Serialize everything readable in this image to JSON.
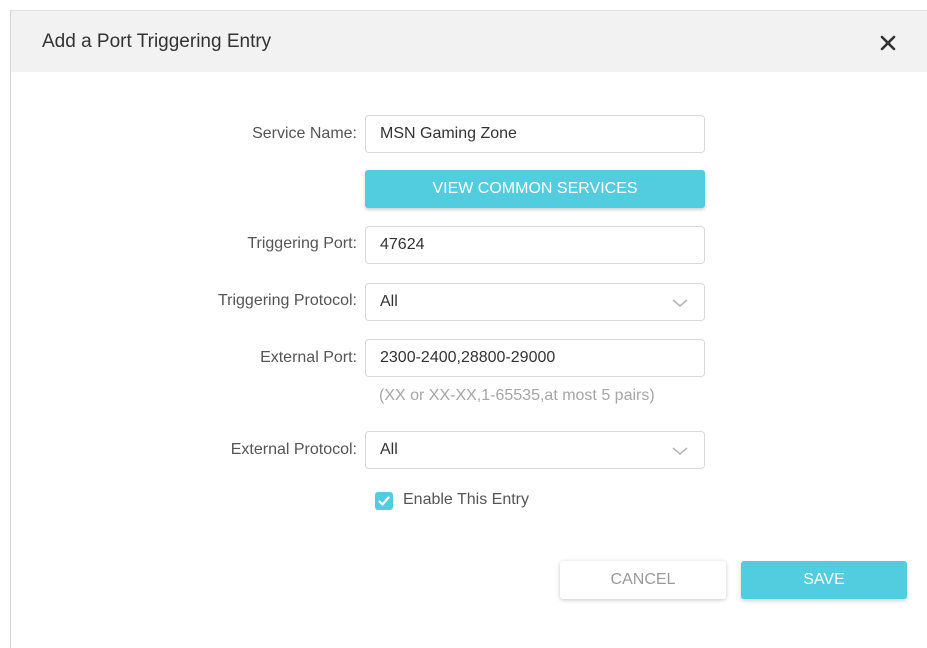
{
  "dialog": {
    "title": "Add a Port Triggering Entry",
    "close_icon": "close-icon"
  },
  "form": {
    "service_name": {
      "label": "Service Name:",
      "value": "MSN Gaming Zone"
    },
    "view_services_label": "VIEW COMMON SERVICES",
    "triggering_port": {
      "label": "Triggering Port:",
      "value": "47624"
    },
    "triggering_protocol": {
      "label": "Triggering Protocol:",
      "value": "All",
      "icon": "chevron-down-icon"
    },
    "external_port": {
      "label": "External Port:",
      "value": "2300-2400,28800-29000",
      "hint": "(XX or XX-XX,1-65535,at most 5 pairs)"
    },
    "external_protocol": {
      "label": "External Protocol:",
      "value": "All",
      "icon": "chevron-down-icon"
    },
    "enable_entry": {
      "label": "Enable This Entry",
      "checked": true,
      "icon": "checkmark-icon"
    }
  },
  "actions": {
    "cancel_label": "CANCEL",
    "save_label": "SAVE"
  },
  "colors": {
    "accent": "#52cde0",
    "header_bg": "#f2f2f2",
    "label_text": "#555555",
    "hint_text": "#a6a6a6"
  }
}
